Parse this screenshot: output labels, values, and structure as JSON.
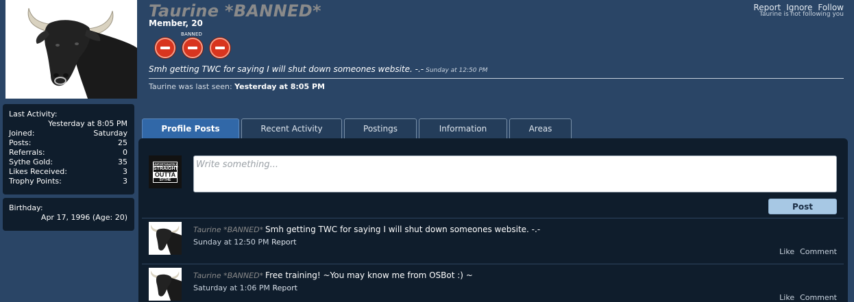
{
  "profile": {
    "username": "Taurine *BANNED*",
    "title": "Member, 20",
    "banned_label": "BANNED",
    "badge_count": 3,
    "status_text": "Smh getting TWC for saying I will shut down someones website. -.-",
    "status_time": "Sunday at 12:50 PM",
    "last_seen_prefix": "Taurine was last seen:",
    "last_seen_value": "Yesterday at 8:05 PM"
  },
  "top_links": {
    "report": "Report",
    "ignore": "Ignore",
    "follow": "Follow",
    "follow_status": "Taurine is not following you"
  },
  "stats": {
    "last_activity_label": "Last Activity:",
    "last_activity_value": "Yesterday at 8:05 PM",
    "rows": [
      {
        "label": "Joined:",
        "value": "Saturday"
      },
      {
        "label": "Posts:",
        "value": "25"
      },
      {
        "label": "Referrals:",
        "value": "0"
      },
      {
        "label": "Sythe Gold:",
        "value": "35"
      },
      {
        "label": "Likes Received:",
        "value": "3"
      },
      {
        "label": "Trophy Points:",
        "value": "3"
      }
    ]
  },
  "birthday": {
    "label": "Birthday:",
    "value": "Apr 17, 1996 (Age: 20)"
  },
  "tabs": [
    {
      "label": "Profile Posts",
      "active": true
    },
    {
      "label": "Recent Activity",
      "active": false
    },
    {
      "label": "Postings",
      "active": false
    },
    {
      "label": "Information",
      "active": false
    },
    {
      "label": "Areas",
      "active": false
    }
  ],
  "composer": {
    "placeholder": "Write something...",
    "post_button": "Post",
    "avatar_text": {
      "l1": "UNFORTUNATELY",
      "l2": "STRAIGHT",
      "l3": "OUTTA",
      "l4": "SYTHE"
    }
  },
  "posts": [
    {
      "author": "Taurine *BANNED*",
      "text": "Smh getting TWC for saying I will shut down someones website. -.-",
      "time": "Sunday at 12:50 PM",
      "report": "Report",
      "like": "Like",
      "comment": "Comment"
    },
    {
      "author": "Taurine *BANNED*",
      "text": "Free training! ~You may know me from OSBot :) ~",
      "time": "Saturday at 1:06 PM",
      "report": "Report",
      "like": "Like",
      "comment": "Comment"
    }
  ],
  "colors": {
    "background": "#2a4566",
    "panel": "#0f1d2c",
    "active_tab": "#3168a8",
    "username": "#8a8a8a",
    "post_button": "#a7c8e4",
    "badge": "#d8351f"
  }
}
